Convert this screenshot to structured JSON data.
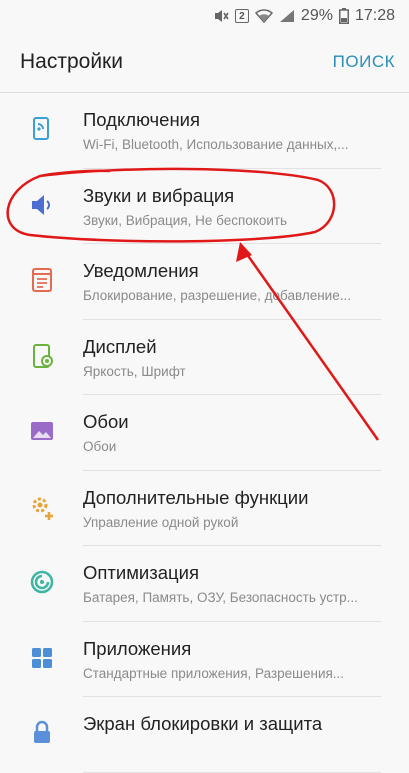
{
  "status_bar": {
    "battery": "29%",
    "time": "17:28",
    "badge": "2"
  },
  "app_bar": {
    "title": "Настройки",
    "search_label": "ПОИСК"
  },
  "settings": [
    {
      "title": "Подключения",
      "subtitle": "Wi-Fi, Bluetooth, Использование данных,...",
      "icon": "connections-icon",
      "color": "#3a9fd6"
    },
    {
      "title": "Звуки и вибрация",
      "subtitle": "Звуки, Вибрация, Не беспокоить",
      "icon": "speaker-icon",
      "color": "#4a6fd0"
    },
    {
      "title": "Уведомления",
      "subtitle": "Блокирование, разрешение, добавление...",
      "icon": "notifications-icon",
      "color": "#e56a52"
    },
    {
      "title": "Дисплей",
      "subtitle": "Яркость, Шрифт",
      "icon": "display-icon",
      "color": "#6bb33e"
    },
    {
      "title": "Обои",
      "subtitle": "Обои",
      "icon": "wallpaper-icon",
      "color": "#9b6bc9"
    },
    {
      "title": "Дополнительные функции",
      "subtitle": "Управление одной рукой",
      "icon": "advanced-features-icon",
      "color": "#e8a33a"
    },
    {
      "title": "Оптимизация",
      "subtitle": "Батарея, Память, ОЗУ, Безопасность устр...",
      "icon": "optimization-icon",
      "color": "#3fb5a3"
    },
    {
      "title": "Приложения",
      "subtitle": "Стандартные приложения, Разрешения...",
      "icon": "apps-icon",
      "color": "#4d8fd6"
    },
    {
      "title": "Экран блокировки и защита",
      "subtitle": "",
      "icon": "lock-screen-icon",
      "color": "#5a8fd9"
    }
  ],
  "annotation": {
    "color": "#e01818"
  }
}
